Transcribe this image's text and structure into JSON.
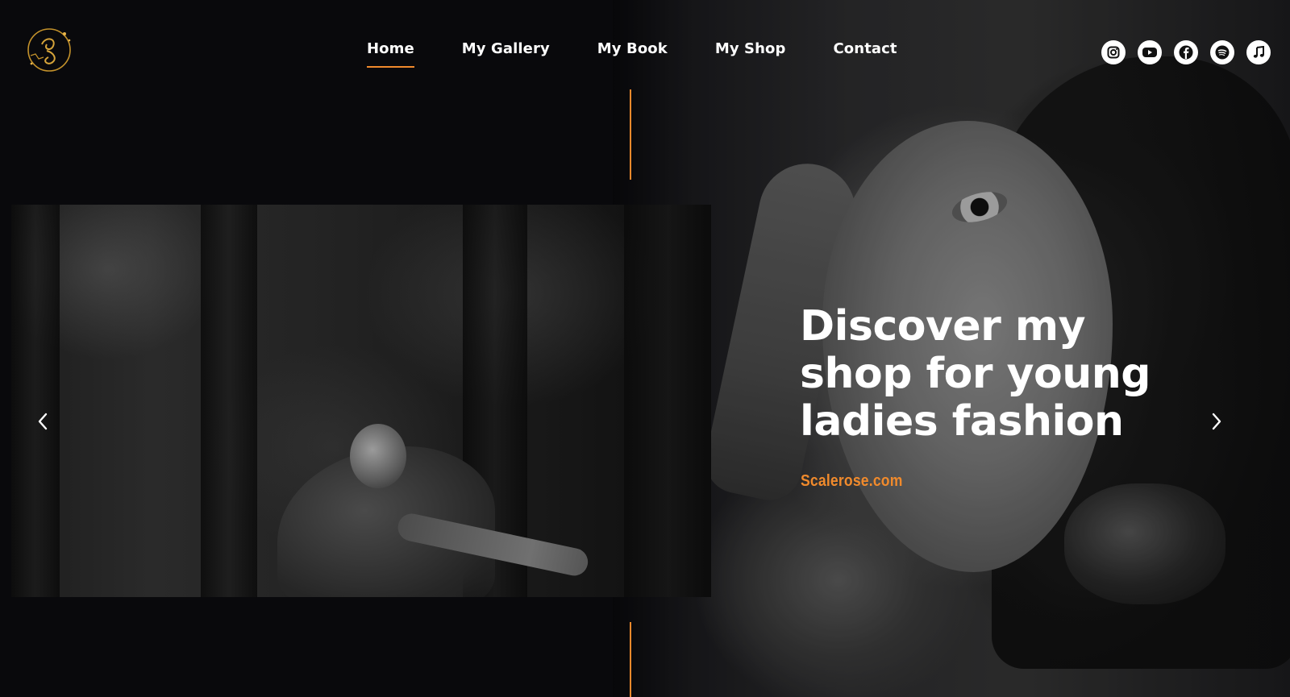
{
  "header": {
    "nav": [
      {
        "label": "Home",
        "active": true
      },
      {
        "label": "My Gallery",
        "active": false
      },
      {
        "label": "My Book",
        "active": false
      },
      {
        "label": "My Shop",
        "active": false
      },
      {
        "label": "Contact",
        "active": false
      }
    ],
    "social": [
      {
        "name": "instagram-icon"
      },
      {
        "name": "youtube-icon"
      },
      {
        "name": "facebook-icon"
      },
      {
        "name": "spotify-icon"
      },
      {
        "name": "music-note-icon"
      }
    ]
  },
  "hero": {
    "headline": "Discover my shop for young ladies fashion",
    "link": "Scalerose.com"
  },
  "colors": {
    "accent": "#f08a2c",
    "text": "#ffffff",
    "background": "#09090c"
  }
}
